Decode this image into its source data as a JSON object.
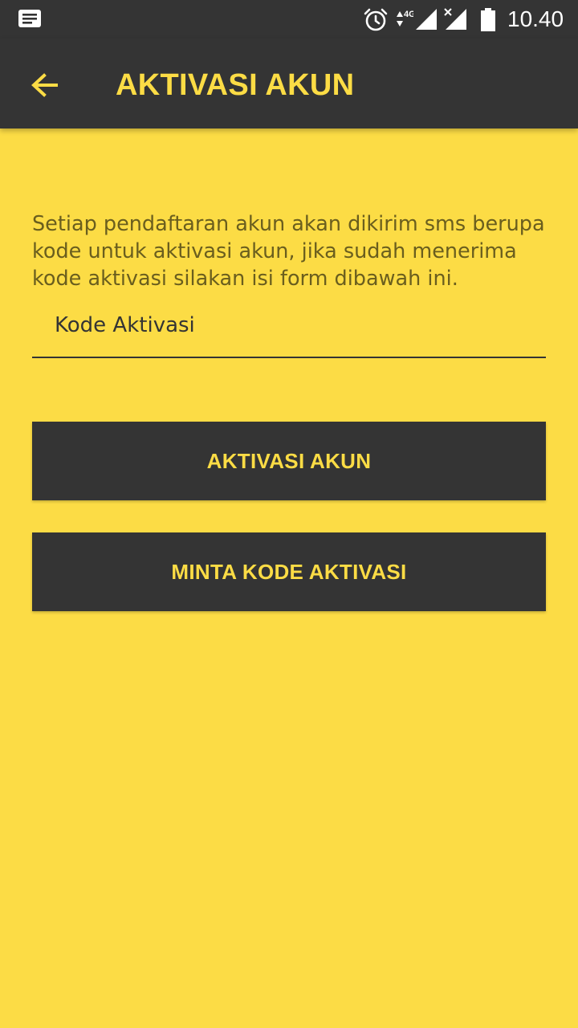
{
  "status_bar": {
    "time": "10.40",
    "network": "4G",
    "icons": [
      "notification-icon",
      "alarm-icon",
      "data-arrows-icon",
      "signal-icon",
      "signal-no-service-icon",
      "battery-icon"
    ]
  },
  "app_bar": {
    "title": "AKTIVASI AKUN",
    "back_icon": "arrow-back-icon"
  },
  "main": {
    "description": "Setiap pendaftaran akun akan dikirim sms berupa kode untuk aktivasi akun, jika sudah menerima kode aktivasi silakan isi form dibawah ini.",
    "activation_code": {
      "placeholder": "Kode Aktivasi",
      "value": ""
    },
    "activate_button_label": "AKTIVASI AKUN",
    "request_code_button_label": "MINTA KODE AKTIVASI"
  },
  "colors": {
    "background": "#FCDC45",
    "bar": "#343434",
    "accent": "#FCDC45",
    "description_text": "#6A5E1E"
  }
}
